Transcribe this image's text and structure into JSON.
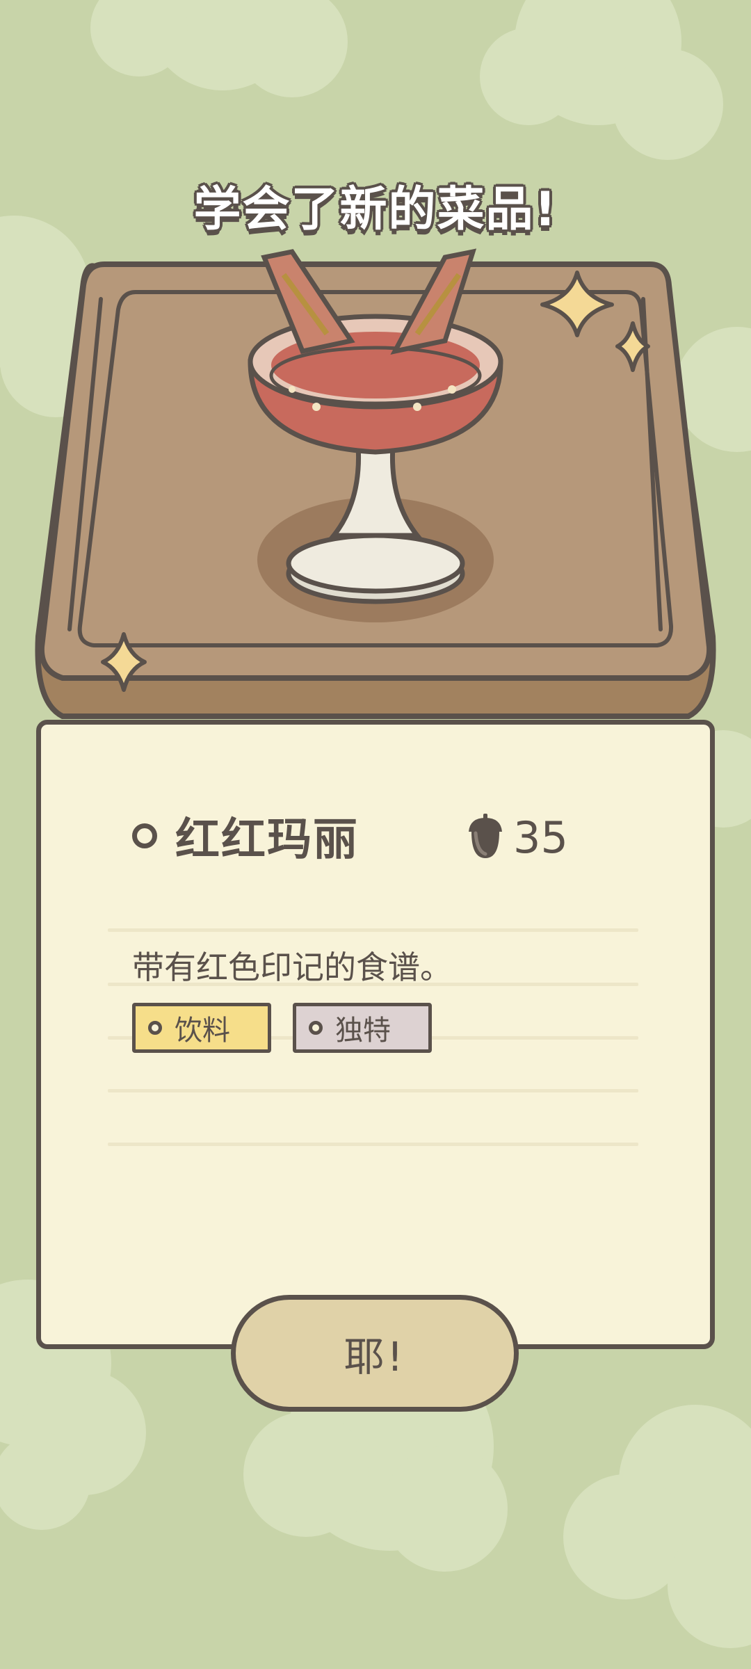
{
  "banner": {
    "title": "学会了新的菜品!"
  },
  "dish": {
    "name": "红红玛丽",
    "price_icon": "acorn-icon",
    "price": "35",
    "description": "带有红色印记的食谱。",
    "tags": [
      "饮料",
      "独特"
    ]
  },
  "actions": {
    "confirm_label": "耶!"
  },
  "colors": {
    "background": "#c8d4a9",
    "card": "#f8f3d9",
    "outline": "#5a514b",
    "tray": "#b6987a",
    "tag_drink": "#f6de8a",
    "tag_unique": "#ddd2d2",
    "button": "#e0d2a8"
  }
}
